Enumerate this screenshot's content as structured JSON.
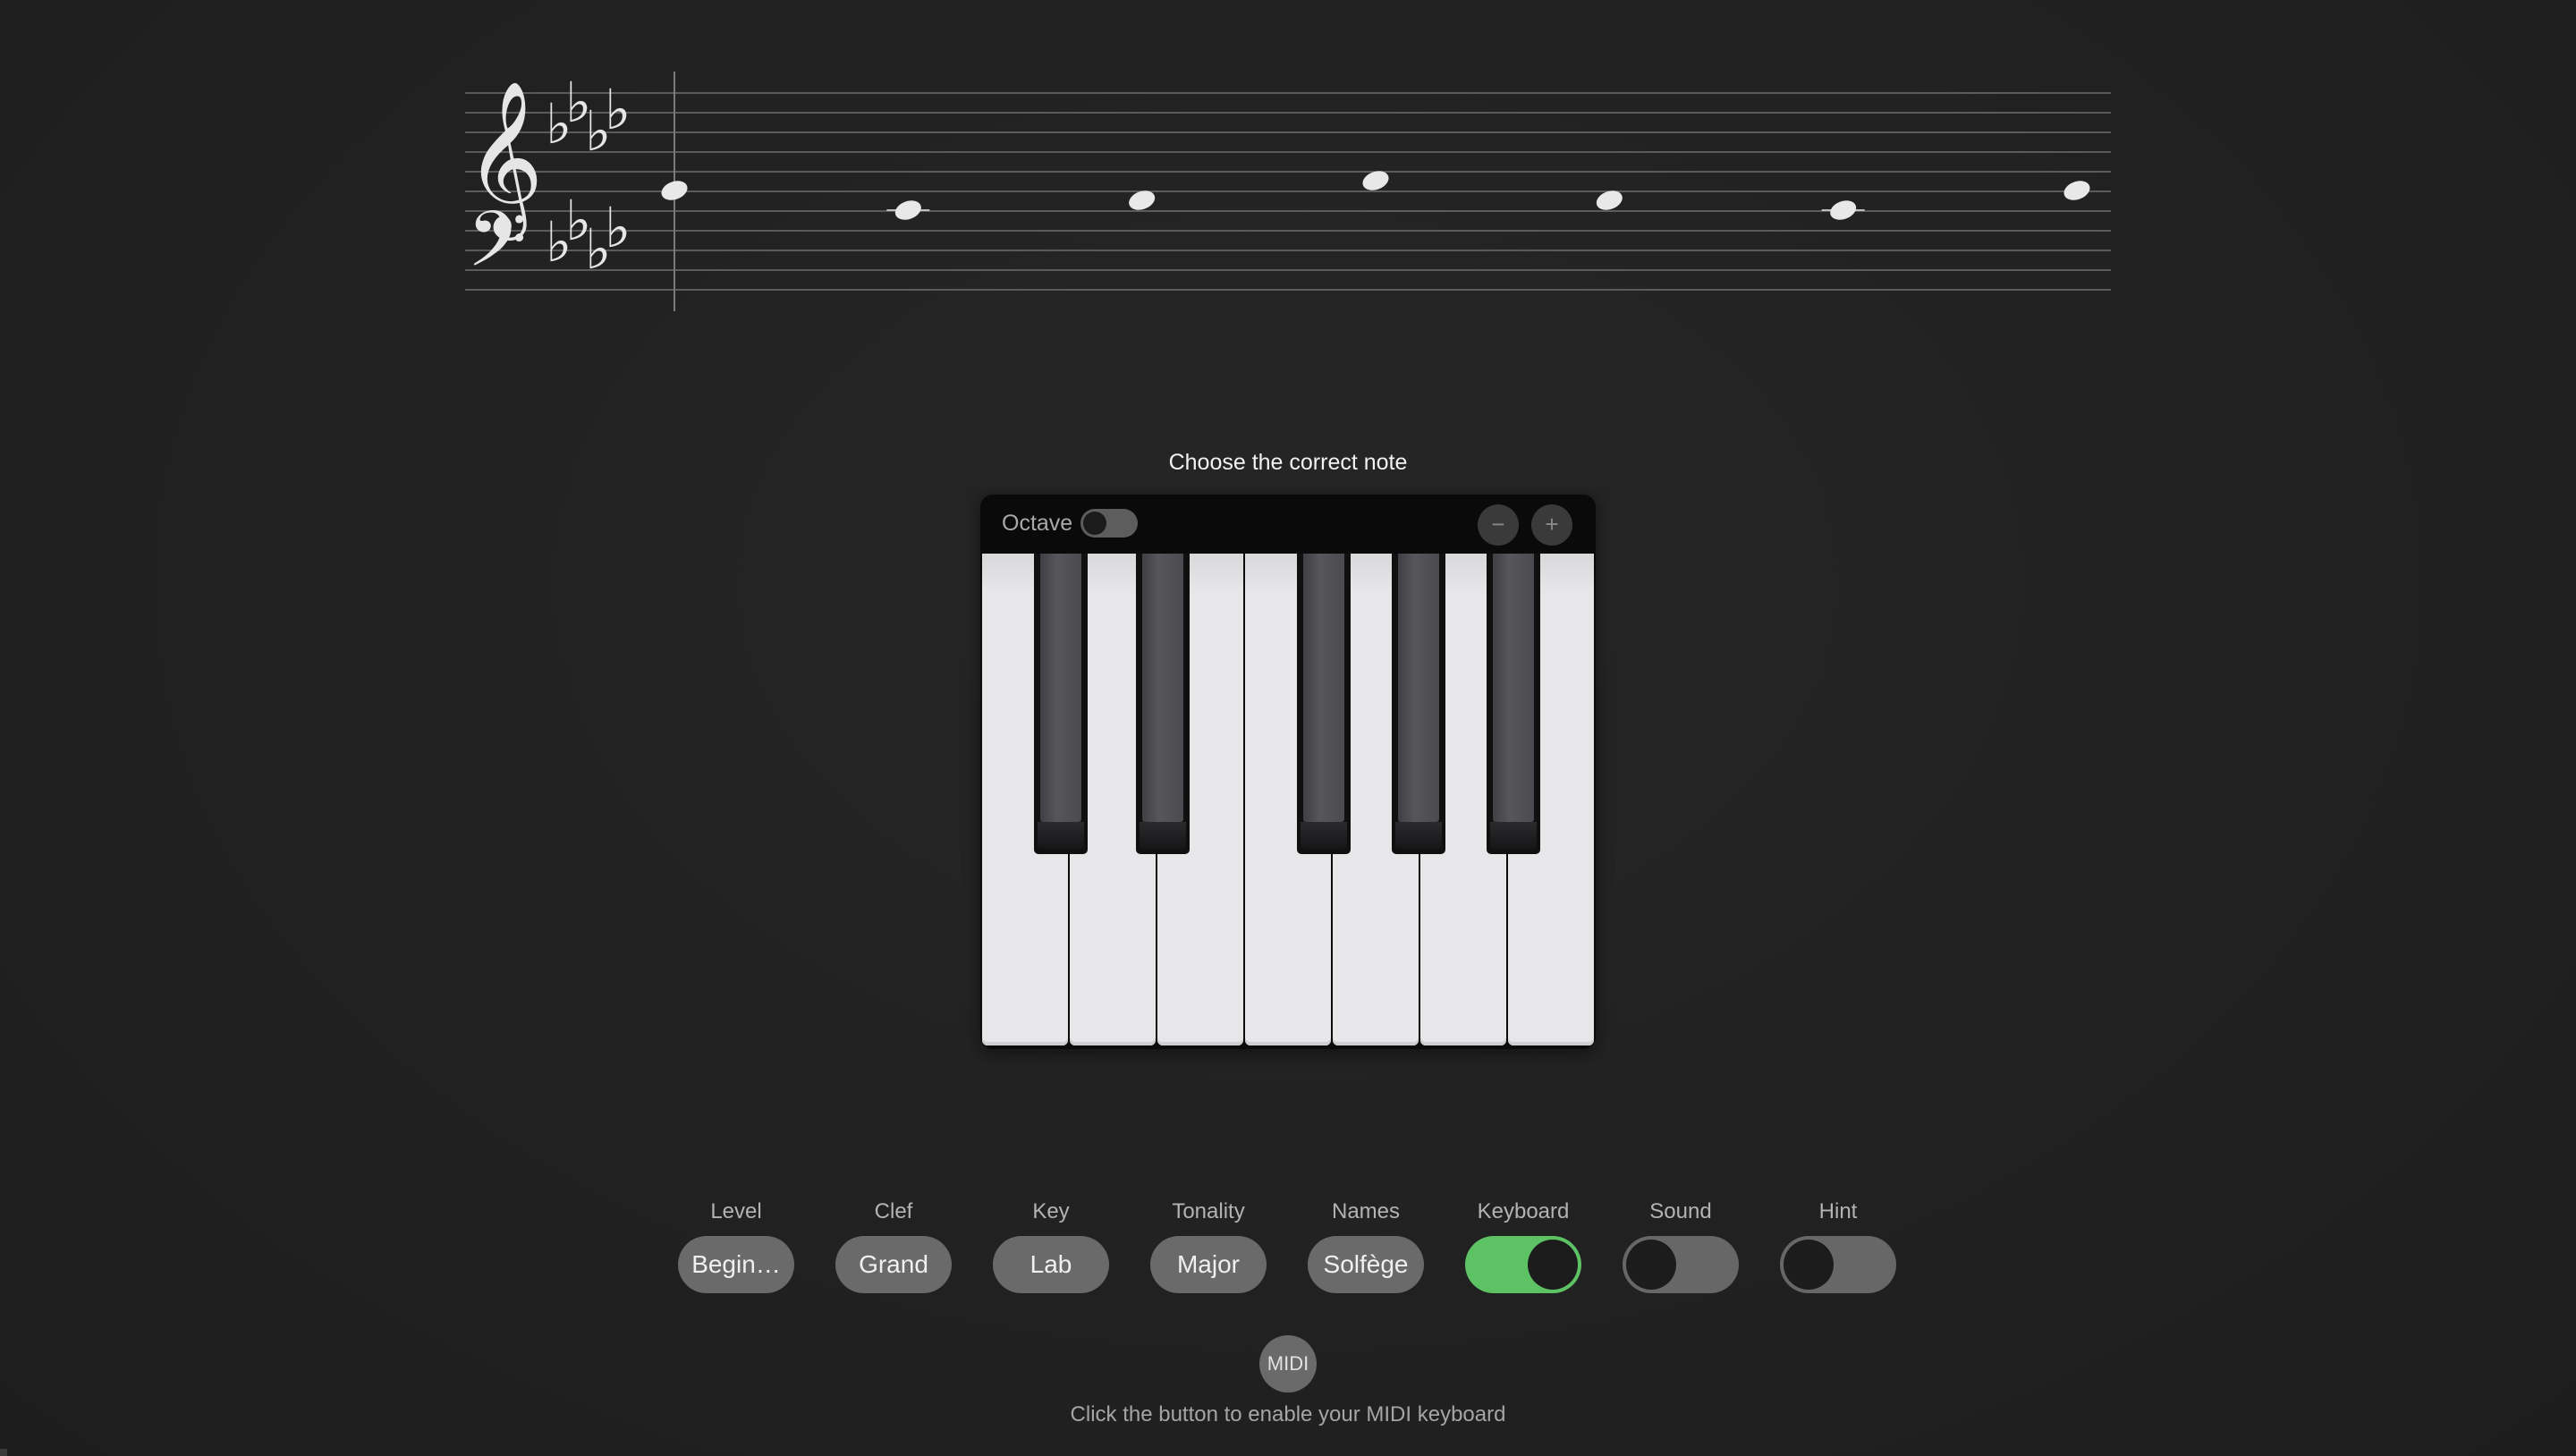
{
  "prompt": "Choose the correct note",
  "staff": {
    "clefs": [
      "treble-clef",
      "bass-clef"
    ],
    "key_signature_flats": 4,
    "notes": [
      {
        "staff_step": 0
      },
      {
        "staff_step": -2
      },
      {
        "staff_step": -1
      },
      {
        "staff_step": 1
      },
      {
        "staff_step": -1
      },
      {
        "staff_step": -2
      },
      {
        "staff_step": 0
      }
    ]
  },
  "piano": {
    "octave_label": "Octave",
    "octave_enabled": false,
    "minus_label": "−",
    "plus_label": "+",
    "white_keys": 7,
    "black_keys": 5
  },
  "controls": {
    "level": {
      "label": "Level",
      "value": "Begin…"
    },
    "clef": {
      "label": "Clef",
      "value": "Grand"
    },
    "key": {
      "label": "Key",
      "value": "Lab"
    },
    "tonality": {
      "label": "Tonality",
      "value": "Major"
    },
    "names": {
      "label": "Names",
      "value": "Solfège"
    },
    "keyboard": {
      "label": "Keyboard",
      "on": true
    },
    "sound": {
      "label": "Sound",
      "on": false
    },
    "hint": {
      "label": "Hint",
      "on": false
    }
  },
  "midi": {
    "button_label": "MIDI",
    "hint": "Click the button to enable your MIDI keyboard"
  },
  "colors": {
    "background": "#222222",
    "toggle_on": "#5dc264",
    "pill": "#6a6a6a",
    "note": "#e8e8e8"
  }
}
